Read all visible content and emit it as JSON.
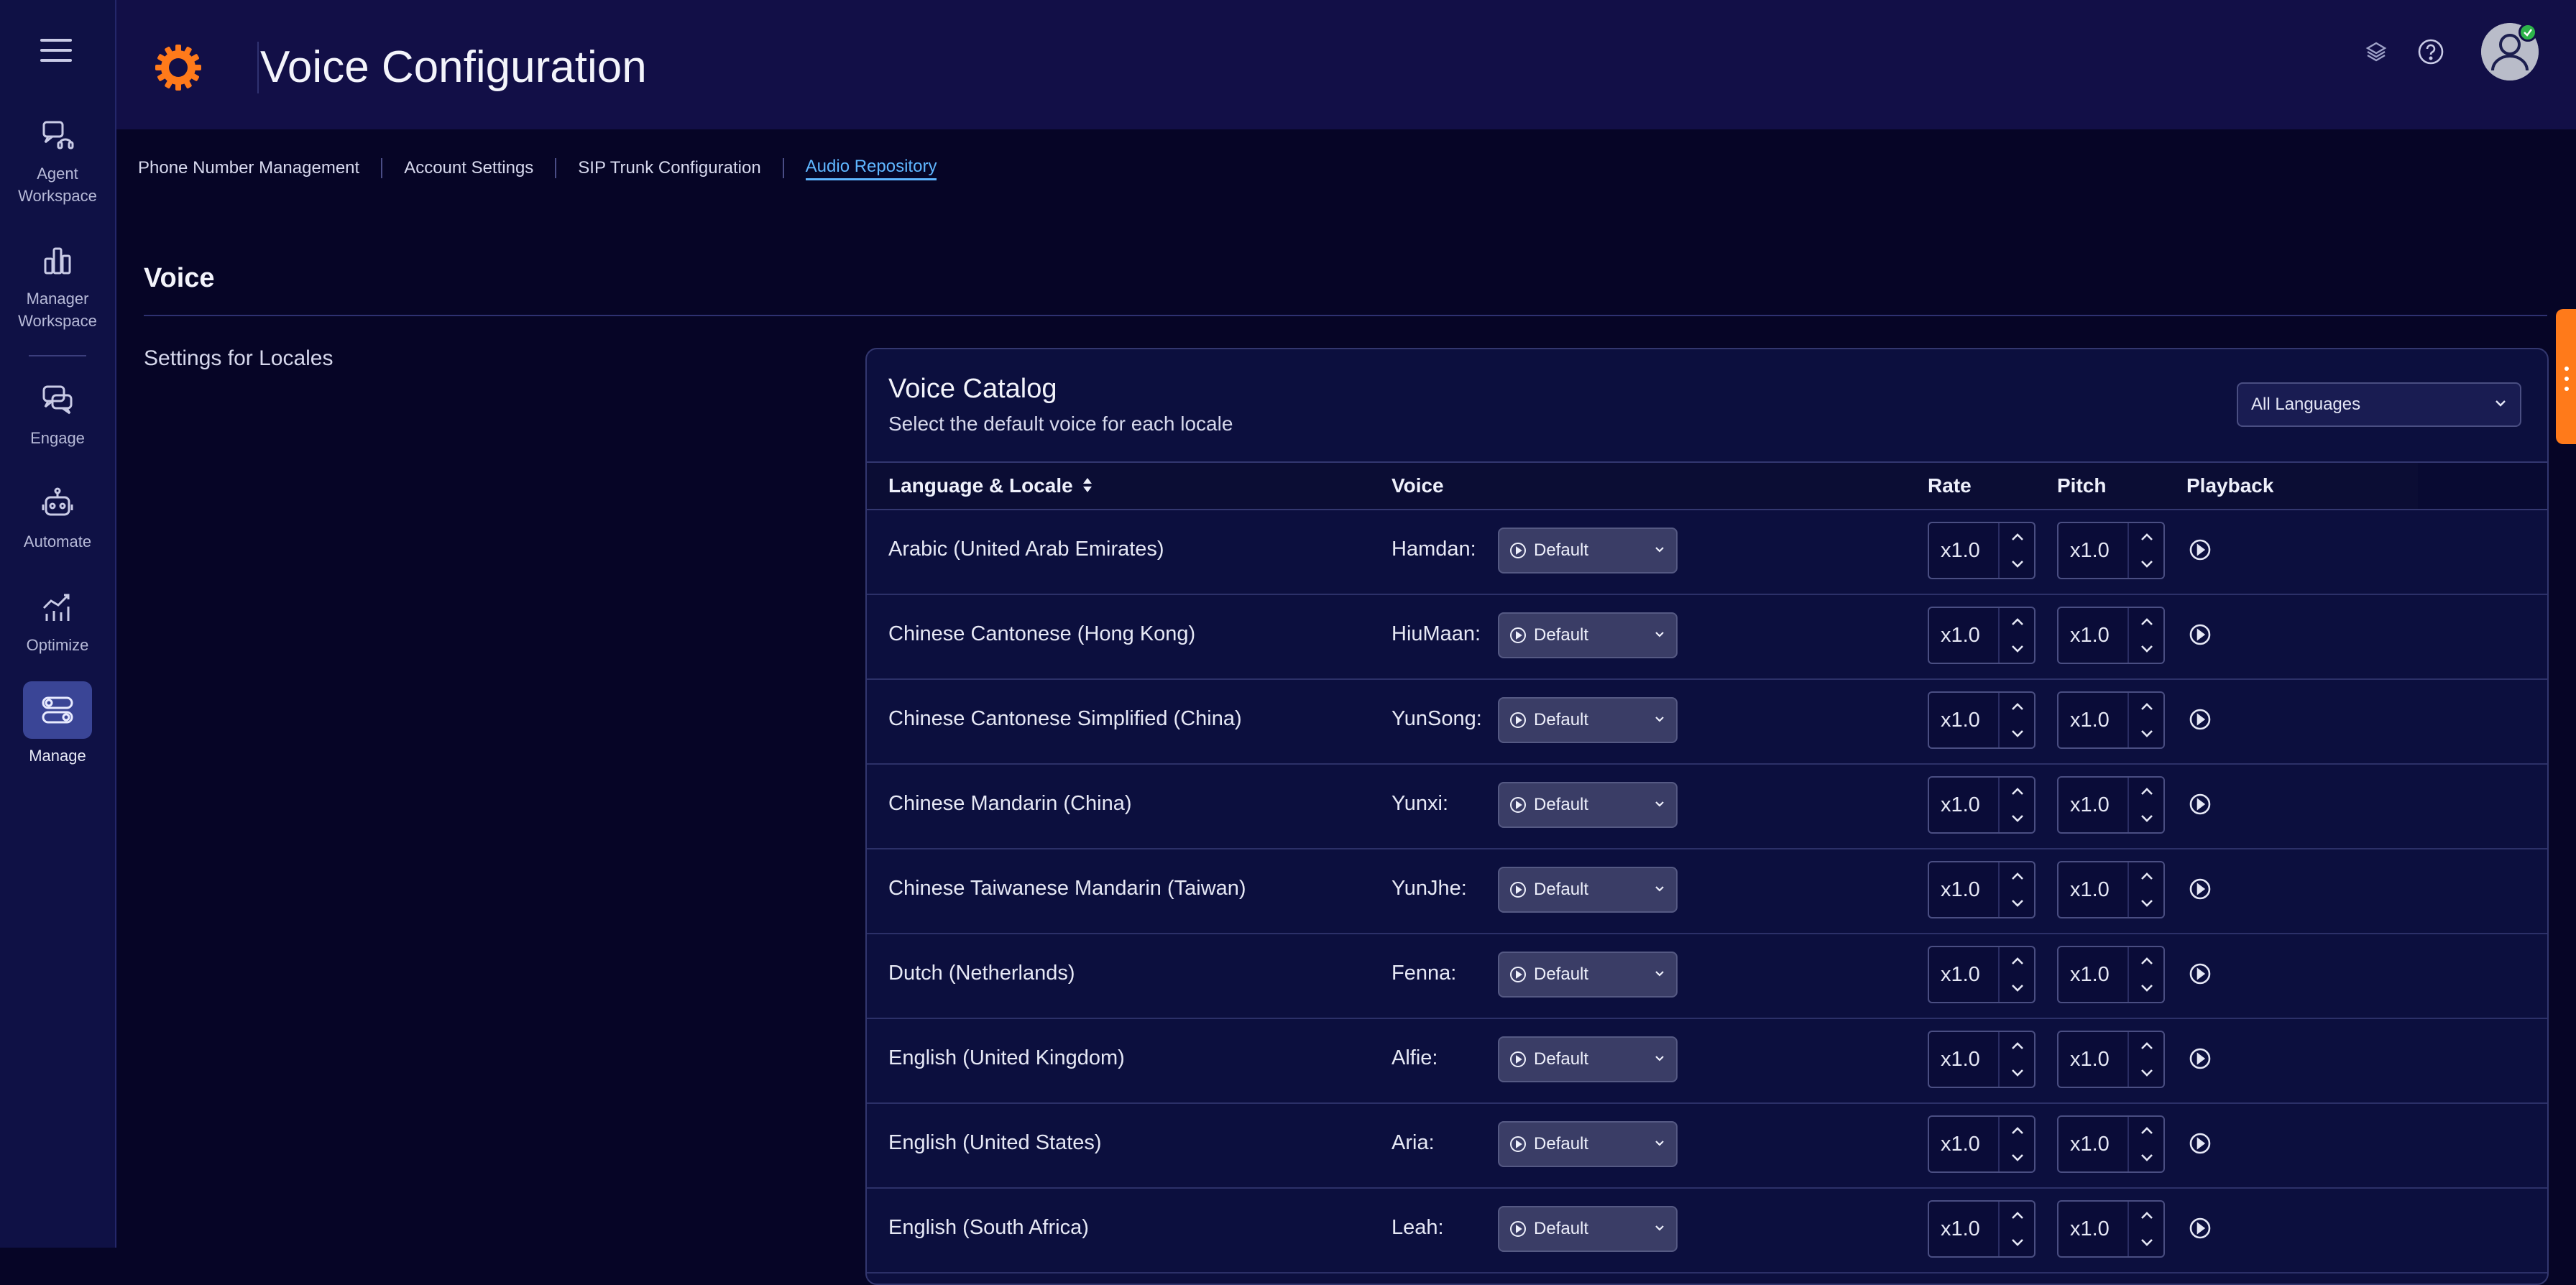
{
  "sidebar": {
    "items": [
      {
        "label_l1": "Agent",
        "label_l2": "Workspace",
        "icon": "headset-chat-icon"
      },
      {
        "label_l1": "Manager",
        "label_l2": "Workspace",
        "icon": "bar-chart-icon"
      },
      {
        "label_l1": "Engage",
        "label_l2": "",
        "icon": "chat-bubbles-icon"
      },
      {
        "label_l1": "Automate",
        "label_l2": "",
        "icon": "robot-icon"
      },
      {
        "label_l1": "Optimize",
        "label_l2": "",
        "icon": "trend-chart-icon"
      },
      {
        "label_l1": "Manage",
        "label_l2": "",
        "icon": "toggles-icon"
      }
    ]
  },
  "header": {
    "title": "Voice Configuration"
  },
  "tabs": [
    {
      "label": "Phone Number Management"
    },
    {
      "label": "Account Settings"
    },
    {
      "label": "SIP Trunk Configuration"
    },
    {
      "label": "Audio Repository"
    }
  ],
  "section": {
    "title": "Voice",
    "settings_label": "Settings for Locales"
  },
  "catalog": {
    "title": "Voice Catalog",
    "subtitle": "Select the default voice for each locale",
    "language_filter": "All Languages",
    "columns": {
      "language": "Language & Locale",
      "voice": "Voice",
      "rate": "Rate",
      "pitch": "Pitch",
      "playback": "Playback"
    },
    "rows": [
      {
        "language": "Arabic (United Arab Emirates)",
        "voice": "Hamdan:",
        "style": "Default",
        "rate": "x1.0",
        "pitch": "x1.0"
      },
      {
        "language": "Chinese Cantonese (Hong Kong)",
        "voice": "HiuMaan:",
        "style": "Default",
        "rate": "x1.0",
        "pitch": "x1.0"
      },
      {
        "language": "Chinese Cantonese Simplified (China)",
        "voice": "YunSong:",
        "style": "Default",
        "rate": "x1.0",
        "pitch": "x1.0"
      },
      {
        "language": "Chinese Mandarin (China)",
        "voice": "Yunxi:",
        "style": "Default",
        "rate": "x1.0",
        "pitch": "x1.0"
      },
      {
        "language": "Chinese Taiwanese Mandarin (Taiwan)",
        "voice": "YunJhe:",
        "style": "Default",
        "rate": "x1.0",
        "pitch": "x1.0"
      },
      {
        "language": "Dutch (Netherlands)",
        "voice": "Fenna:",
        "style": "Default",
        "rate": "x1.0",
        "pitch": "x1.0"
      },
      {
        "language": "English (United Kingdom)",
        "voice": "Alfie:",
        "style": "Default",
        "rate": "x1.0",
        "pitch": "x1.0"
      },
      {
        "language": "English (United States)",
        "voice": "Aria:",
        "style": "Default",
        "rate": "x1.0",
        "pitch": "x1.0"
      },
      {
        "language": "English (South Africa)",
        "voice": "Leah:",
        "style": "Default",
        "rate": "x1.0",
        "pitch": "x1.0"
      }
    ]
  },
  "colors": {
    "background": "#060526",
    "header": "#120f47",
    "sidebar": "#0f1145",
    "accent_link": "#5fb6ff",
    "brand_orange": "#ff7a1a",
    "status_online": "#2db34a"
  }
}
